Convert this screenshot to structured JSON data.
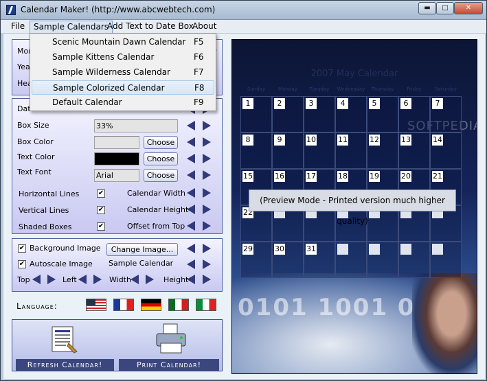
{
  "window": {
    "title": "Calendar Maker! (http://www.abcwebtech.com)"
  },
  "menu": {
    "items": [
      {
        "label": "File"
      },
      {
        "label": "Sample Calendars"
      },
      {
        "label": "Add Text to Date Box"
      },
      {
        "label": "About"
      }
    ],
    "dropdown": [
      {
        "label": "Scenic Mountain Dawn Calendar",
        "shortcut": "F5"
      },
      {
        "label": "Sample Kittens Calendar",
        "shortcut": "F6"
      },
      {
        "label": "Sample Wilderness Calendar",
        "shortcut": "F7"
      },
      {
        "label": "Sample Colorized Calendar",
        "shortcut": "F8"
      },
      {
        "label": "Default Calendar",
        "shortcut": "F9"
      }
    ]
  },
  "settings_top": {
    "mo_label": "Mon",
    "yea_label": "Yea",
    "hea_label": "Hea"
  },
  "settings_box": {
    "dat_label": "Dat",
    "box_size_label": "Box Size",
    "box_size_value": "33%",
    "box_color_label": "Box Color",
    "text_color_label": "Text Color",
    "text_font_label": "Text Font",
    "text_font_value": "Arial",
    "choose": "Choose",
    "colors": {
      "box": "#e4e4e4",
      "text": "#000000"
    },
    "horizontal_lines": "Horizontal Lines",
    "vertical_lines": "Vertical Lines",
    "shaded_boxes": "Shaded Boxes",
    "calendar_width": "Calendar Width",
    "calendar_height": "Calendar Height",
    "offset_from_top": "Offset from Top",
    "check_mark": "✔"
  },
  "background": {
    "background_image": "Background Image",
    "change_image": "Change Image...",
    "autoscale_image": "Autoscale Image",
    "sample_calendar": "Sample Calendar",
    "top": "Top",
    "left": "Left",
    "width": "Width",
    "height": "Height"
  },
  "language": {
    "label": "Language:"
  },
  "actions": {
    "refresh": "Refresh Calendar!",
    "print": "Print Calendar!"
  },
  "preview": {
    "title": "2007 May Calendar",
    "days": [
      "Sunday",
      "Monday",
      "Tuesday",
      "Wednesday",
      "Thursday",
      "Friday",
      "Saturday"
    ],
    "weeks": [
      [
        "1",
        "2",
        "3",
        "4",
        "5",
        "6",
        "7"
      ],
      [
        "8",
        "9",
        "10",
        "11",
        "12",
        "13",
        "14"
      ],
      [
        "15",
        "16",
        "17",
        "18",
        "19",
        "20",
        "21"
      ],
      [
        "22",
        "",
        "",
        "",
        "",
        "",
        ""
      ],
      [
        "29",
        "30",
        "31",
        "",
        "",
        "",
        ""
      ]
    ],
    "banner": "(Preview Mode - Printed version much higher quality)",
    "watermark": "SOFTPEDIA"
  }
}
